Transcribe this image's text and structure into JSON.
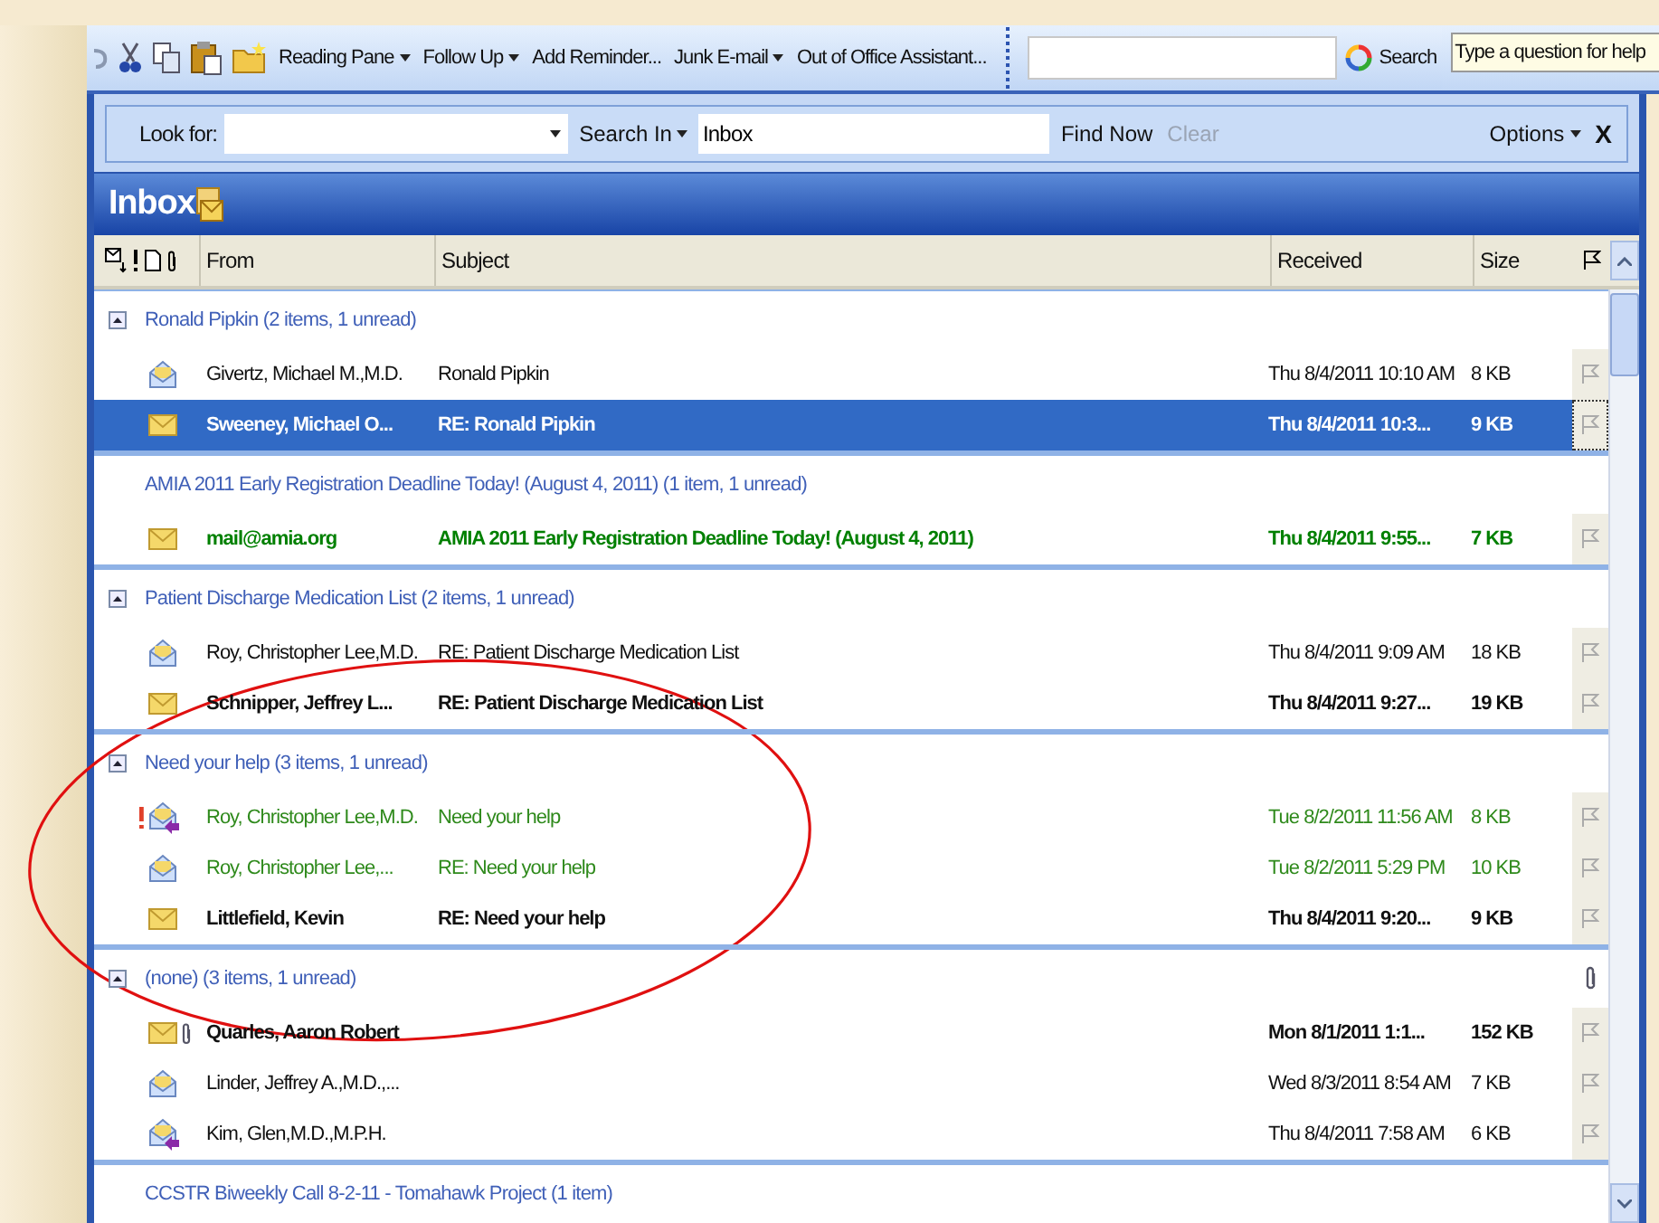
{
  "toolbar": {
    "buttons": [
      {
        "label": "Reading Pane",
        "dropdown": true
      },
      {
        "label": "Follow Up",
        "dropdown": true
      },
      {
        "label": "Add Reminder...",
        "dropdown": false
      },
      {
        "label": "Junk E-mail",
        "dropdown": true
      },
      {
        "label": "Out of Office Assistant...",
        "dropdown": false
      }
    ],
    "search_button": "Search",
    "help": {
      "placeholder": "Type a question for help"
    }
  },
  "find_bar": {
    "look_for": "Look for:",
    "search_in": "Search In",
    "scope": "Inbox",
    "find_now": "Find Now",
    "clear": {
      "label": "Clear",
      "disabled": true
    },
    "options": "Options",
    "close": "X"
  },
  "folder": {
    "title": "Inbox"
  },
  "columns": [
    {
      "label": "From"
    },
    {
      "label": "Subject"
    },
    {
      "label": "Received"
    },
    {
      "label": "Size"
    }
  ],
  "groups": [
    {
      "title": "Ronald Pipkin (2 items, 1 unread)",
      "collapse_button": true,
      "attachment": false,
      "items": [
        {
          "kind": "read",
          "important": false,
          "attachment": false,
          "from": "Givertz, Michael M.,M.D.",
          "subject": "Ronald Pipkin",
          "received": "Thu 8/4/2011 10:10 AM",
          "size": "8 KB",
          "unread": false,
          "selected": false
        },
        {
          "kind": "unread",
          "important": false,
          "attachment": false,
          "from": "Sweeney, Michael O...",
          "subject": "RE: Ronald Pipkin",
          "received": "Thu 8/4/2011 10:3...",
          "size": "9 KB",
          "unread": true,
          "selected": true
        }
      ]
    },
    {
      "title": "AMIA 2011 Early Registration Deadline Today!  (August 4, 2011) (1 item, 1 unread)",
      "collapse_button": false,
      "attachment": false,
      "items": [
        {
          "kind": "unread",
          "important": false,
          "attachment": false,
          "from": "mail@amia.org",
          "subject": "AMIA 2011 Early Registration Deadline Today!  (August 4, 2011)",
          "received": "Thu 8/4/2011 9:55...",
          "size": "7 KB",
          "unread": true,
          "selected": false,
          "color": "#008000"
        }
      ]
    },
    {
      "title": "Patient Discharge Medication List (2 items, 1 unread)",
      "collapse_button": true,
      "attachment": false,
      "items": [
        {
          "kind": "read",
          "important": false,
          "attachment": false,
          "from": "Roy, Christopher Lee,M.D.",
          "subject": "RE: Patient Discharge Medication List",
          "received": "Thu 8/4/2011 9:09 AM",
          "size": "18 KB",
          "unread": false,
          "selected": false
        },
        {
          "kind": "unread",
          "important": false,
          "attachment": false,
          "from": "Schnipper, Jeffrey L...",
          "subject": "RE: Patient Discharge Medication List",
          "received": "Thu 8/4/2011 9:27...",
          "size": "19 KB",
          "unread": true,
          "selected": false
        }
      ]
    },
    {
      "title": "Need your help  (3 items, 1 unread)",
      "collapse_button": true,
      "attachment": false,
      "items": [
        {
          "kind": "replied",
          "important": true,
          "attachment": false,
          "from": "Roy, Christopher Lee,M.D.",
          "subject": "Need your help",
          "received": "Tue 8/2/2011 11:56 AM",
          "size": "8 KB",
          "unread": false,
          "selected": false,
          "color": "#2f8a1c"
        },
        {
          "kind": "read",
          "important": false,
          "attachment": false,
          "from": "Roy, Christopher Lee,...",
          "subject": "RE: Need your help",
          "received": "Tue 8/2/2011 5:29 PM",
          "size": "10 KB",
          "unread": false,
          "selected": false,
          "color": "#2f8a1c"
        },
        {
          "kind": "unread",
          "important": false,
          "attachment": false,
          "from": "Littlefield, Kevin",
          "subject": "RE: Need your help",
          "received": "Thu 8/4/2011 9:20...",
          "size": "9 KB",
          "unread": true,
          "selected": false
        }
      ]
    },
    {
      "title": "(none) (3 items, 1 unread)",
      "collapse_button": true,
      "attachment": true,
      "items": [
        {
          "kind": "unread",
          "important": false,
          "attachment": true,
          "from": "Quarles, Aaron Robert",
          "received": "Mon 8/1/2011 1:1...",
          "size": "152 KB",
          "unread": true,
          "selected": false
        },
        {
          "kind": "read",
          "important": false,
          "attachment": false,
          "from": "Linder, Jeffrey A.,M.D.,...",
          "received": "Wed 8/3/2011 8:54 AM",
          "size": "7 KB",
          "unread": false,
          "selected": false
        },
        {
          "kind": "replied",
          "important": false,
          "attachment": false,
          "from": "Kim, Glen,M.D.,M.P.H.",
          "received": "Thu 8/4/2011 7:58 AM",
          "size": "6 KB",
          "unread": false,
          "selected": false
        }
      ]
    },
    {
      "title": "CCSTR Biweekly Call 8-2-11 - Tomahawk Project (1 item)",
      "collapse_button": false,
      "attachment": false
    }
  ]
}
